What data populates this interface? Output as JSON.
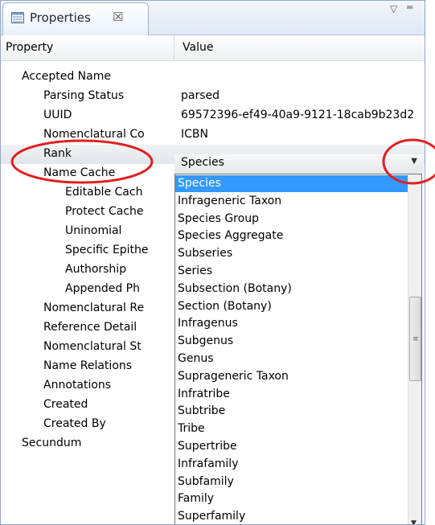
{
  "tab": {
    "title": "Properties",
    "close_glyph": "☒",
    "menu_glyph": "▽",
    "minimize_glyph": "═"
  },
  "table": {
    "headers": {
      "property": "Property",
      "value": "Value"
    },
    "rows": [
      {
        "label": "Accepted Name",
        "value": "",
        "indent": 1
      },
      {
        "label": "Parsing Status",
        "value": "parsed",
        "indent": 2
      },
      {
        "label": "UUID",
        "value": "69572396-ef49-40a9-9121-18cab9b23d2",
        "indent": 2
      },
      {
        "label": "Nomenclatural Co",
        "value": "ICBN",
        "indent": 2
      },
      {
        "label": "Rank",
        "value": "",
        "indent": 2,
        "selected": true
      },
      {
        "label": "Name Cache",
        "value": "",
        "indent": 2
      },
      {
        "label": "Editable Cach",
        "value": "",
        "indent": 3
      },
      {
        "label": "Protect Cache",
        "value": "",
        "indent": 3
      },
      {
        "label": "Uninomial",
        "value": "",
        "indent": 3
      },
      {
        "label": "Specific Epithe",
        "value": "",
        "indent": 3
      },
      {
        "label": "Authorship",
        "value": "",
        "indent": 3
      },
      {
        "label": "Appended Ph",
        "value": "",
        "indent": 3
      },
      {
        "label": "Nomenclatural Re",
        "value": "",
        "indent": 2
      },
      {
        "label": "Reference Detail",
        "value": "",
        "indent": 2
      },
      {
        "label": "Nomenclatural St",
        "value": "",
        "indent": 2
      },
      {
        "label": "Name Relations",
        "value": "",
        "indent": 2
      },
      {
        "label": "Annotations",
        "value": "",
        "indent": 2
      },
      {
        "label": "Created",
        "value": "",
        "indent": 2
      },
      {
        "label": "Created By",
        "value": "",
        "indent": 2
      },
      {
        "label": "Secundum",
        "value": "",
        "indent": 1
      }
    ]
  },
  "rank_combo": {
    "value": "Species",
    "options": [
      "Species",
      "Infrageneric Taxon",
      "Species Group",
      "Species Aggregate",
      "Subseries",
      "Series",
      "Subsection (Botany)",
      "Section (Botany)",
      "Infragenus",
      "Subgenus",
      "Genus",
      "Suprageneric Taxon",
      "Infratribe",
      "Subtribe",
      "Tribe",
      "Supertribe",
      "Infrafamily",
      "Subfamily",
      "Family",
      "Superfamily"
    ],
    "highlighted": "Species"
  },
  "colors": {
    "highlight": "#3399ff",
    "annotation": "#e02020",
    "tab_border": "#9db3d2"
  }
}
